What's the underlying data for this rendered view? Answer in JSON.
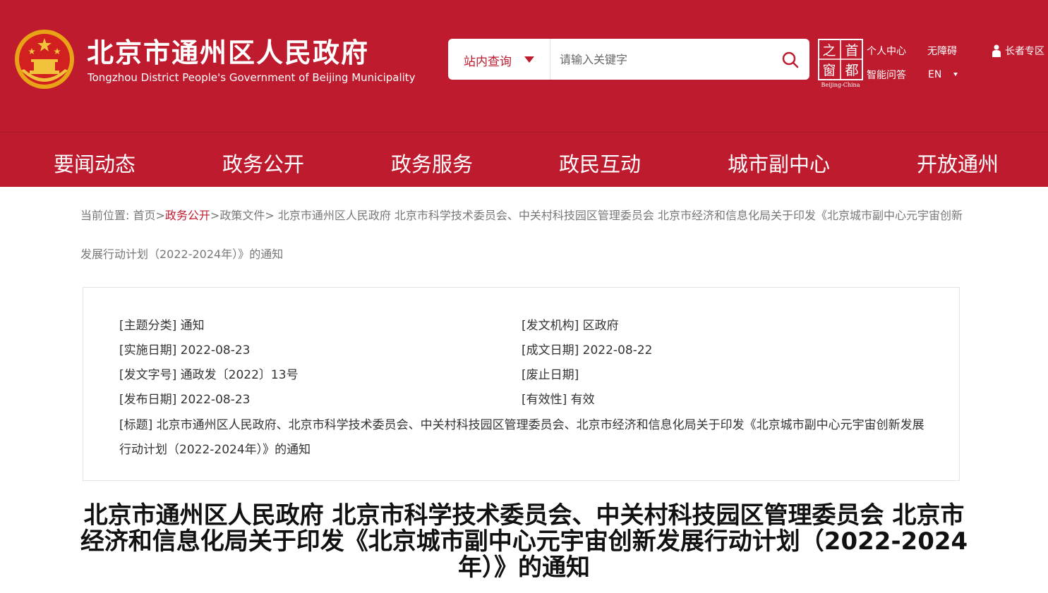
{
  "header": {
    "title_cn": "北京市通州区人民政府",
    "title_en": "Tongzhou District People's Government of Beijing Municipality",
    "search": {
      "scope_label": "站内查询",
      "placeholder": "请输入关键字"
    },
    "capital_logo": {
      "chars": [
        "之",
        "首",
        "窗",
        "都"
      ],
      "caption": "Beijing-China"
    },
    "links": {
      "personal_center": "个人中心",
      "accessibility": "无障碍",
      "smart_qa": "智能问答",
      "lang": "EN",
      "elder_zone": "长者专区"
    },
    "colors": {
      "brand_red": "#be1b2e"
    }
  },
  "nav": {
    "items": [
      "要闻动态",
      "政务公开",
      "政务服务",
      "政民互动",
      "城市副中心",
      "开放通州"
    ]
  },
  "breadcrumb": {
    "prefix": "当前位置: ",
    "home": "首页",
    "sep": ">",
    "section": "政务公开",
    "category": "政策文件",
    "current": " 北京市通州区人民政府 北京市科学技术委员会、中关村科技园区管理委员会 北京市经济和信息化局关于印发《北京城市副中心元宇宙创新发展行动计划（2022-2024年）》的通知"
  },
  "info": {
    "topic": "[主题分类] 通知",
    "issuer": "[发文机构] 区政府",
    "effective_date": "[实施日期] 2022-08-23",
    "creation_date": "[成文日期] 2022-08-22",
    "doc_number": "[发文字号] 通政发〔2022〕13号",
    "abolish_date": "[废止日期]",
    "publish_date": "[发布日期] 2022-08-23",
    "validity": "[有效性] 有效",
    "title": "[标题] 北京市通州区人民政府、北京市科学技术委员会、中关村科技园区管理委员会、北京市经济和信息化局关于印发《北京城市副中心元宇宙创新发展行动计划（2022-2024年）》的通知"
  },
  "article": {
    "title": "北京市通州区人民政府 北京市科学技术委员会、中关村科技园区管理委员会 北京市经济和信息化局关于印发《北京城市副中心元宇宙创新发展行动计划（2022-2024年）》的通知"
  }
}
